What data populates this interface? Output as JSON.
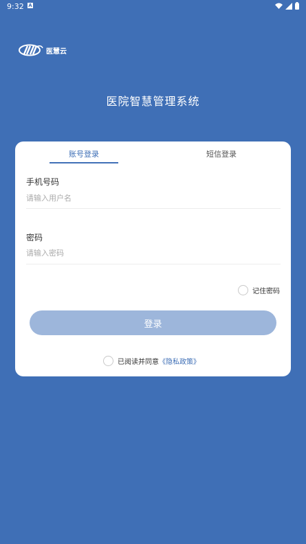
{
  "status": {
    "time": "9:32",
    "notification_icon": "A"
  },
  "logo": {
    "text": "医慧云"
  },
  "app_title": "医院智慧管理系统",
  "tabs": [
    {
      "label": "账号登录",
      "active": true
    },
    {
      "label": "短信登录",
      "active": false
    }
  ],
  "form": {
    "phone_label": "手机号码",
    "phone_placeholder": "请输入用户名",
    "password_label": "密码",
    "password_placeholder": "请输入密码",
    "remember_label": "记住密码",
    "login_label": "登录"
  },
  "agreement": {
    "text": "已阅读并同意",
    "link": "《隐私政策》"
  },
  "colors": {
    "background": "#3f6fb6",
    "accent": "#3f6fb6",
    "button_disabled": "#9db6db"
  }
}
